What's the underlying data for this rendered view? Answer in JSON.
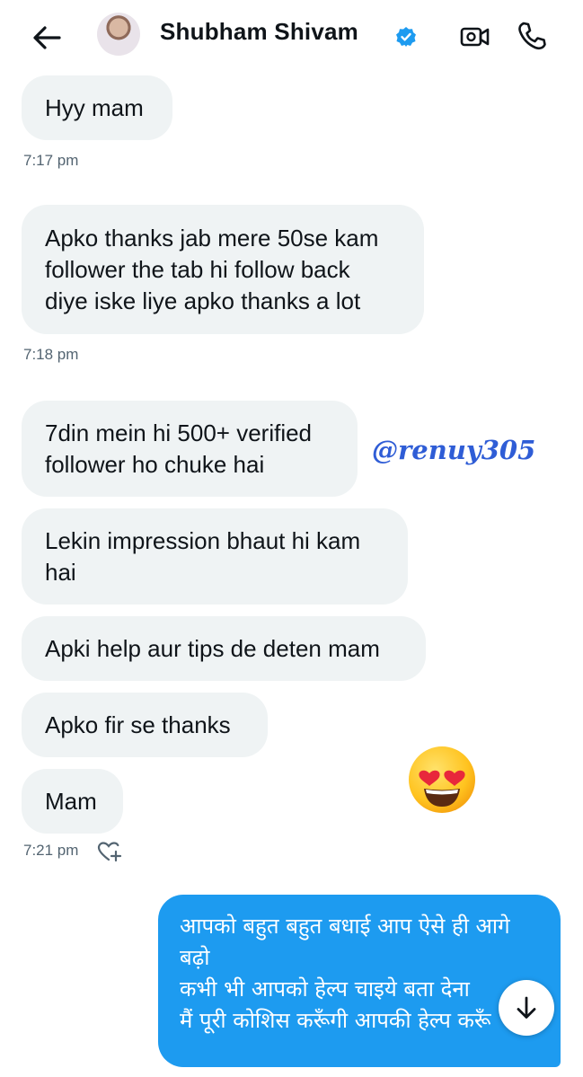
{
  "header": {
    "contact_name": "Shubham Shivam",
    "icons": [
      "back-arrow-icon",
      "verified-badge-icon",
      "video-call-icon",
      "phone-call-icon"
    ],
    "verified_color": "#1d9bf0"
  },
  "messages": [
    {
      "text": "Hyy mam"
    },
    {
      "time": "7:17 pm"
    },
    {
      "text": "Apko thanks jab mere 50se kam\nfollower the tab hi follow back\ndiye iske liye apko thanks a lot"
    },
    {
      "time": "7:18 pm"
    },
    {
      "text": "7din mein hi 500+ verified\nfollower ho chuke hai"
    },
    {
      "text": "Lekin impression bhaut hi kam\nhai"
    },
    {
      "text": "Apki help aur tips de deten mam"
    },
    {
      "text": "Apko fir se thanks"
    },
    {
      "text": "Mam"
    },
    {
      "time": "7:21 pm"
    }
  ],
  "outgoing": {
    "text": "आपको बहुत बहुत बधाई आप ऐसे ही आगे\nबढ़ो\nकभी भी आपको हेल्प चाइये बता देना\nमैं पूरी कोशिस करूँगी आपकी हेल्प करूँ",
    "color": "#1d9bf0"
  },
  "overlay": {
    "watermark": "@renuy305",
    "emoji": "smiling-face-with-heart-eyes"
  },
  "colors": {
    "incoming_bubble": "#eff3f4",
    "timestamp": "#536471"
  }
}
